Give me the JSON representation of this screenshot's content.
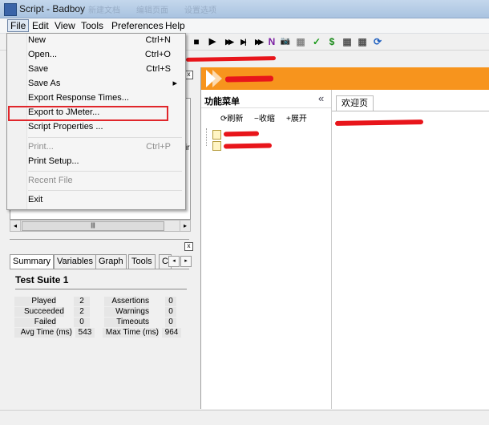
{
  "window": {
    "title": "Script - Badboy",
    "blurred_title_bits": [
      "新建文档",
      "编辑页面",
      "设置选项"
    ]
  },
  "menubar": {
    "items": [
      "File",
      "Edit",
      "View",
      "Tools",
      "Preferences",
      "Help"
    ]
  },
  "file_menu": {
    "new": {
      "label": "New",
      "shortcut": "Ctrl+N"
    },
    "open": {
      "label": "Open...",
      "shortcut": "Ctrl+O"
    },
    "save": {
      "label": "Save",
      "shortcut": "Ctrl+S"
    },
    "save_as": {
      "label": "Save As",
      "arrow": "▸"
    },
    "export_response": {
      "label": "Export Response Times..."
    },
    "export_jmeter": {
      "label": "Export to JMeter..."
    },
    "script_props": {
      "label": "Script Properties ..."
    },
    "print": {
      "label": "Print...",
      "shortcut": "Ctrl+P"
    },
    "print_setup": {
      "label": "Print Setup..."
    },
    "recent": {
      "label": "Recent File"
    },
    "exit": {
      "label": "Exit"
    }
  },
  "toolbar": {
    "glyphs": [
      "■",
      "▶",
      "▶▶",
      "▶|",
      "▶▶",
      "N",
      "📷",
      "▦",
      "✓",
      "$",
      "▦",
      "▦",
      "⟳"
    ]
  },
  "left_top": {
    "partial_text": "ir",
    "scroll_grip": "|||"
  },
  "summary": {
    "tabs": [
      "Summary",
      "Variables",
      "Graph",
      "Tools",
      "C"
    ],
    "heading": "Test Suite 1",
    "rows": [
      {
        "l1": "Played",
        "v1": "2",
        "l2": "Assertions",
        "v2": "0"
      },
      {
        "l1": "Succeeded",
        "v1": "2",
        "l2": "Warnings",
        "v2": "0"
      },
      {
        "l1": "Failed",
        "v1": "0",
        "l2": "Timeouts",
        "v2": "0"
      },
      {
        "l1": "Avg Time (ms)",
        "v1": "543",
        "l2": "Max Time (ms)",
        "v2": "964"
      }
    ]
  },
  "browser": {
    "nav_title": "功能菜单",
    "collapse": "«",
    "refresh": "刷新",
    "collapse_all": "收缩",
    "expand_all": "展开",
    "tab_welcome": "欢迎页"
  },
  "colors": {
    "accent": "#f7941d",
    "redline": "#e8151b"
  }
}
